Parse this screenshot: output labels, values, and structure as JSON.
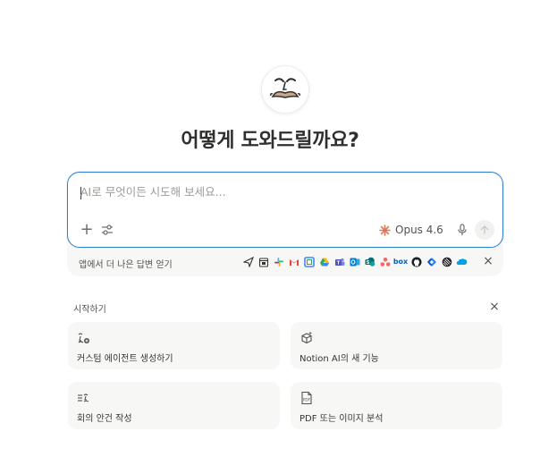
{
  "header": {
    "title": "어떻게 도와드릴까요?",
    "avatar_icon": "mustache-face-icon"
  },
  "composer": {
    "placeholder": "AI로 무엇이든 시도해 보세요...",
    "value": "",
    "model_label": "Opus 4.6",
    "model_icon": "claude-sparkle-icon",
    "accent_color": "#2f80d1",
    "model_icon_color": "#d97757"
  },
  "apps_bar": {
    "label": "앱에서 더 나은 답변 얻기",
    "icons": [
      "paper-plane-icon",
      "calendar-icon",
      "slack-icon",
      "gmail-icon",
      "google-calendar-icon",
      "google-drive-icon",
      "teams-icon",
      "outlook-icon",
      "sharepoint-icon",
      "asana-icon",
      "box-icon",
      "github-icon",
      "jira-icon",
      "linear-icon",
      "salesforce-icon"
    ],
    "box_text": "box"
  },
  "getting_started": {
    "title": "시작하기",
    "cards": [
      {
        "label": "커스텀 에이전트 생성하기",
        "icon": "custom-agent-icon"
      },
      {
        "label": "Notion AI의 새 기능",
        "icon": "cube-sparkle-icon"
      },
      {
        "label": "회의 안건 작성",
        "icon": "meeting-notes-icon"
      },
      {
        "label": "PDF 또는 이미지 분석",
        "icon": "pdf-file-icon",
        "pdf_badge": "PDF"
      }
    ]
  }
}
